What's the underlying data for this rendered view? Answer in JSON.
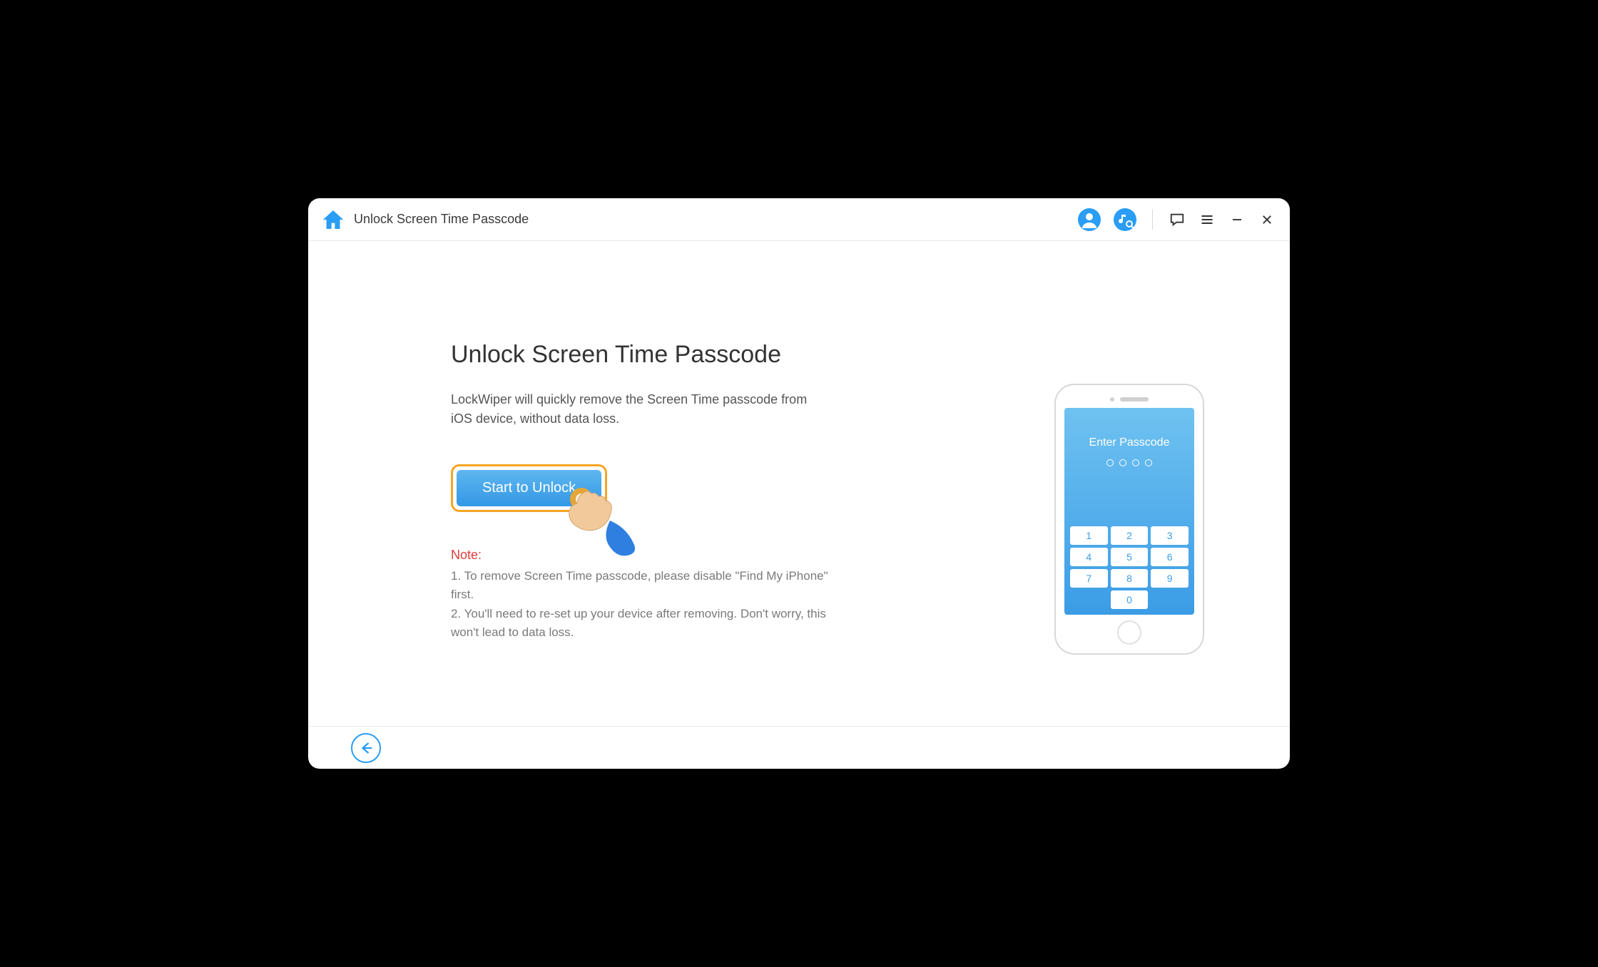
{
  "titlebar": {
    "title": "Unlock Screen Time Passcode"
  },
  "main": {
    "heading": "Unlock Screen Time Passcode",
    "description": "LockWiper will quickly remove the Screen Time passcode from iOS device, without data loss.",
    "start_button": "Start to Unlock",
    "note_heading": "Note:",
    "note_line1": "1. To remove Screen Time passcode, please disable \"Find My iPhone\" first.",
    "note_line2": "2. You'll need to re-set up your device after removing. Don't worry, this won't lead to data loss."
  },
  "phone": {
    "screen_title": "Enter Passcode",
    "keys": [
      "1",
      "2",
      "3",
      "4",
      "5",
      "6",
      "7",
      "8",
      "9",
      "0"
    ]
  },
  "colors": {
    "accent": "#2a9df4",
    "highlight": "#f5a623",
    "error": "#e33b3b"
  }
}
